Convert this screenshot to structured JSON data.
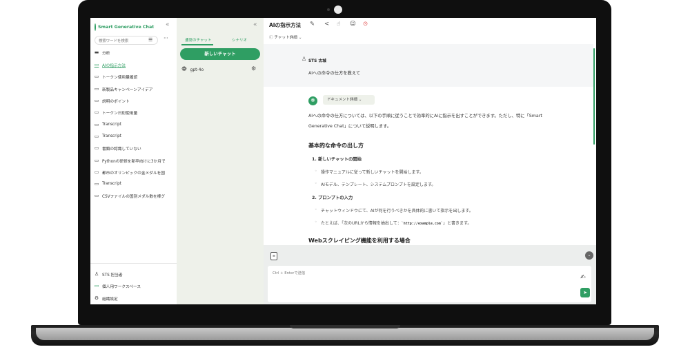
{
  "app": {
    "logo": "Smart Generative Chat"
  },
  "sidebar": {
    "search_placeholder": "検索ワードを検索",
    "items": [
      {
        "label": "分析",
        "icon": "folder-icon"
      },
      {
        "label": "AIの指示方法",
        "icon": "chat-bubble-icon",
        "active": true
      },
      {
        "label": "トークン使用量確認",
        "icon": "chat-bubble-icon"
      },
      {
        "label": "新製品キャンペーンアイデア",
        "icon": "chat-bubble-icon"
      },
      {
        "label": "説明のポイント",
        "icon": "chat-bubble-icon"
      },
      {
        "label": "トークン日別使用量",
        "icon": "chat-bubble-icon"
      },
      {
        "label": "Transcript",
        "icon": "chat-bubble-icon"
      },
      {
        "label": "Transcript",
        "icon": "chat-bubble-icon"
      },
      {
        "label": "書類の認識していない",
        "icon": "chat-bubble-icon"
      },
      {
        "label": "Pythonの研修を新卒向けに3か月で",
        "icon": "chat-bubble-icon"
      },
      {
        "label": "都市のオリンピックの金メダルを国",
        "icon": "chat-bubble-icon"
      },
      {
        "label": "Transcript",
        "icon": "chat-bubble-icon"
      },
      {
        "label": "CSVファイルの国別メダル数を棒グ",
        "icon": "chat-bubble-icon"
      }
    ],
    "footer": [
      {
        "label": "STS 担当者",
        "icon": "user-icon"
      },
      {
        "label": "個人用ワークスペース",
        "icon": "workspace-icon"
      },
      {
        "label": "組織設定",
        "icon": "gear-icon"
      }
    ]
  },
  "middle": {
    "tabs": [
      "通常のチャット",
      "シナリオ"
    ],
    "new_chat": "新しいチャット",
    "model": "gpt-4o"
  },
  "chat": {
    "title": "AIの指示方法",
    "detail_dropdown": "チャット詳細",
    "user": {
      "name": "STS 古城",
      "message": "AIへの命令の仕方を教えて"
    },
    "assistant": {
      "doc_detail": "ドキュメント詳細",
      "intro_line1": "AIへの命令の仕方については、以下の手順に従うことで効率的にAIに指示を出すことができます。ただし、特に「Smart",
      "intro_line2": "Generative Chat」について説明します。",
      "heading1": "基本的な命令の出し方",
      "step1": "1.  新しいチャットの開始",
      "step1_b1": "操作マニュアルに従って新しいチャットを開始します。",
      "step1_b2": "AIモデル、テンプレート、システムプロンプトを設定します。",
      "step2": "2.  プロンプトの入力",
      "step2_b1": "チャットウィンドウにて、AIが何を行うべきかを具体的に書いて指示を出します。",
      "step2_b2_pre": "たとえば、「次のURLから情報を抽出して：",
      "step2_b2_code": "`http://example.com`",
      "step2_b2_post": "」と書きます。",
      "heading2": "Webスクレイピング機能を利用する場合"
    },
    "input_placeholder": "Ctrl + Enterで送信"
  },
  "colors": {
    "accent": "#2f9e63",
    "panel": "#eef1ea"
  }
}
